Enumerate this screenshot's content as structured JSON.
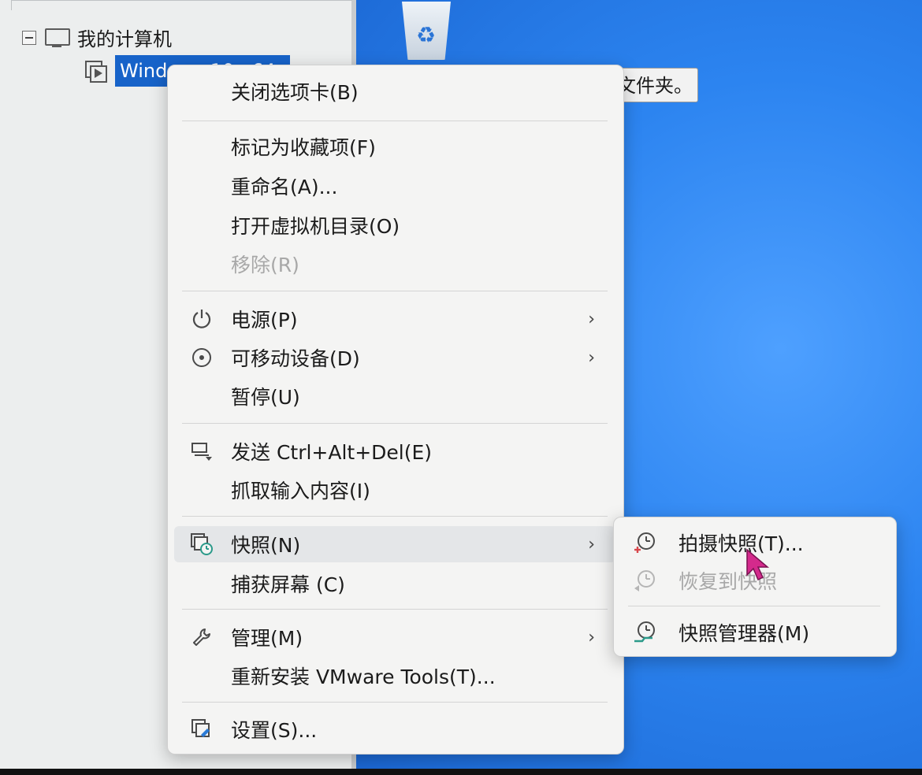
{
  "library": {
    "root_label": "我的计算机",
    "vm_label": "Windows 10 x64"
  },
  "tooltip": {
    "text": "文件夹。"
  },
  "context_menu": {
    "items": [
      {
        "label": "关闭选项卡(B)"
      },
      {
        "label": "标记为收藏项(F)"
      },
      {
        "label": "重命名(A)..."
      },
      {
        "label": "打开虚拟机目录(O)"
      },
      {
        "label": "移除(R)"
      },
      {
        "label": "电源(P)",
        "icon": "power-icon"
      },
      {
        "label": "可移动设备(D)",
        "icon": "removable-device-icon"
      },
      {
        "label": "暂停(U)"
      },
      {
        "label": "发送 Ctrl+Alt+Del(E)",
        "icon": "send-keys-icon"
      },
      {
        "label": "抓取输入内容(I)"
      },
      {
        "label": "快照(N)",
        "icon": "snapshot-icon"
      },
      {
        "label": "捕获屏幕 (C)"
      },
      {
        "label": "管理(M)",
        "icon": "wrench-icon"
      },
      {
        "label": "重新安装 VMware Tools(T)..."
      },
      {
        "label": "设置(S)...",
        "icon": "settings-icon"
      }
    ],
    "submenu_arrow": "›"
  },
  "snapshot_submenu": {
    "items": [
      {
        "label": "拍摄快照(T)...",
        "icon": "take-snapshot-icon"
      },
      {
        "label": "恢复到快照",
        "icon": "revert-snapshot-icon"
      },
      {
        "label": "快照管理器(M)",
        "icon": "snapshot-manager-icon"
      }
    ]
  },
  "colors": {
    "selection": "#1763c9",
    "desktop": "#2c84f0",
    "menu_bg": "#f4f4f3",
    "disabled_text": "#a8a8a8"
  }
}
